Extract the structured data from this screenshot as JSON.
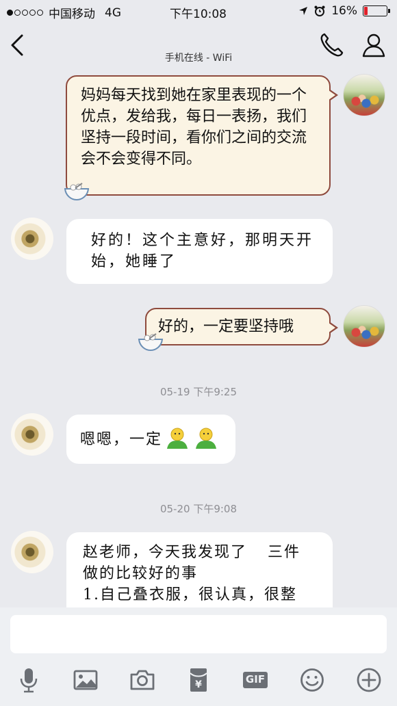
{
  "status_bar": {
    "carrier": "中国移动",
    "network": "4G",
    "time": "下午10:08",
    "battery": "16%",
    "battery_level": 0.16
  },
  "header": {
    "subtitle": "手机在线 - WiFi"
  },
  "messages": [
    {
      "direction": "out",
      "text": "妈妈每天找到她在家里表现的一个优点，发给我，每日一表扬，我们坚持一段时间，看你们之间的交流会不会变得不同。"
    },
    {
      "direction": "in",
      "text": "好的！这个主意好，那明天开始，她睡了"
    },
    {
      "direction": "out",
      "text": "好的，一定要坚持哦"
    },
    {
      "timestamp": "05-19 下午9:25"
    },
    {
      "direction": "in",
      "text": "嗯嗯，一定"
    },
    {
      "timestamp": "05-20 下午9:08"
    },
    {
      "direction": "in",
      "text_line1": "赵老师，今天我发现了",
      "text_line1b": "三件",
      "text_line2": "做的比较好的事",
      "text_line3": "1.自己叠衣服，很认真，很整"
    }
  ],
  "composer": {
    "value": "",
    "gif_label": "GIF"
  },
  "colors": {
    "background": "#e9eaee",
    "out_bubble": "#fbf4e4",
    "out_border": "#8e4a3d",
    "in_bubble": "#ffffff",
    "battery_low": "#e0202a"
  },
  "icons": [
    "back-icon",
    "phone-icon",
    "profile-icon",
    "microphone-icon",
    "image-icon",
    "camera-icon",
    "red-packet-icon",
    "gif-icon",
    "emoji-icon",
    "plus-icon"
  ]
}
